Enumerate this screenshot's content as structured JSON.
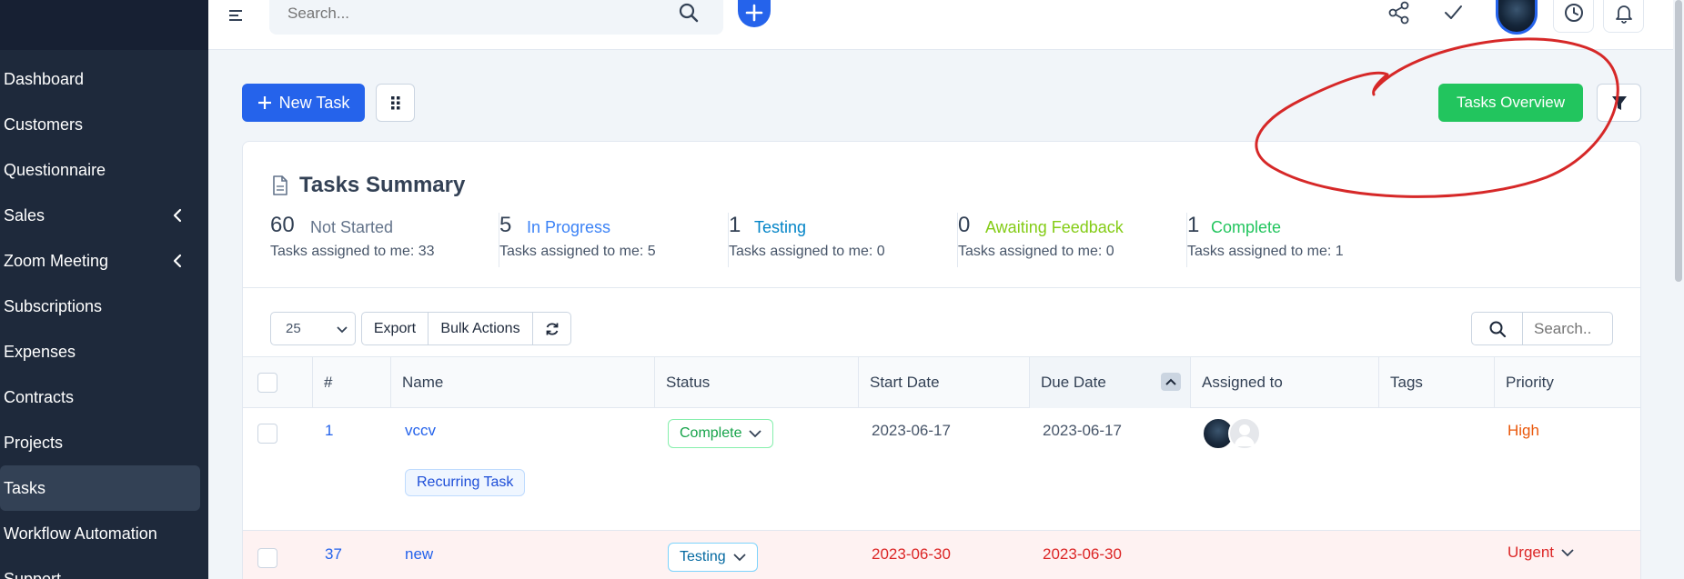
{
  "sidebar": {
    "items": [
      {
        "label": "Dashboard"
      },
      {
        "label": "Customers"
      },
      {
        "label": "Questionnaire"
      },
      {
        "label": "Sales",
        "has_submenu": true
      },
      {
        "label": "Zoom Meeting",
        "has_submenu": true
      },
      {
        "label": "Subscriptions"
      },
      {
        "label": "Expenses"
      },
      {
        "label": "Contracts"
      },
      {
        "label": "Projects"
      },
      {
        "label": "Tasks",
        "active": true
      },
      {
        "label": "Workflow Automation"
      },
      {
        "label": "Support"
      }
    ]
  },
  "topbar": {
    "search_placeholder": "Search...",
    "icons": [
      "menu-icon",
      "search-icon",
      "plus-icon",
      "share-icon",
      "check-icon",
      "user-avatar",
      "clock-icon",
      "bell-icon"
    ]
  },
  "actions": {
    "new_task": "New Task",
    "tasks_overview": "Tasks Overview"
  },
  "summary": {
    "title": "Tasks Summary",
    "stats": [
      {
        "count": "60",
        "label": "Not Started",
        "color": "#64748b",
        "sub": "Tasks assigned to me: 33"
      },
      {
        "count": "5",
        "label": "In Progress",
        "color": "#3b82f6",
        "sub": "Tasks assigned to me: 5"
      },
      {
        "count": "1",
        "label": "Testing",
        "color": "#0284c7",
        "sub": "Tasks assigned to me: 0"
      },
      {
        "count": "0",
        "label": "Awaiting Feedback",
        "color": "#84cc16",
        "sub": "Tasks assigned to me: 0"
      },
      {
        "count": "1",
        "label": "Complete",
        "color": "#22c55e",
        "sub": "Tasks assigned to me: 1"
      }
    ]
  },
  "table_controls": {
    "page_length": "25",
    "export": "Export",
    "bulk_actions": "Bulk Actions",
    "search_placeholder": "Search.."
  },
  "table": {
    "columns": [
      "#",
      "Name",
      "Status",
      "Start Date",
      "Due Date",
      "Assigned to",
      "Tags",
      "Priority"
    ],
    "rows": [
      {
        "id": "1",
        "name": "vccv",
        "status": "Complete",
        "start": "2023-06-17",
        "due": "2023-06-17",
        "tags": "",
        "priority": "High",
        "priority_color": "#ea580c",
        "badge": "Recurring Task"
      },
      {
        "id": "37",
        "name": "new",
        "status": "Testing",
        "start": "2023-06-30",
        "due": "2023-06-30",
        "tags": "",
        "priority": "Urgent",
        "priority_color": "#dc2626"
      }
    ]
  },
  "colors": {
    "sidebar_bg": "#1e293b",
    "primary": "#2563eb",
    "success": "#22c55e",
    "annotation_red": "#d62828"
  }
}
